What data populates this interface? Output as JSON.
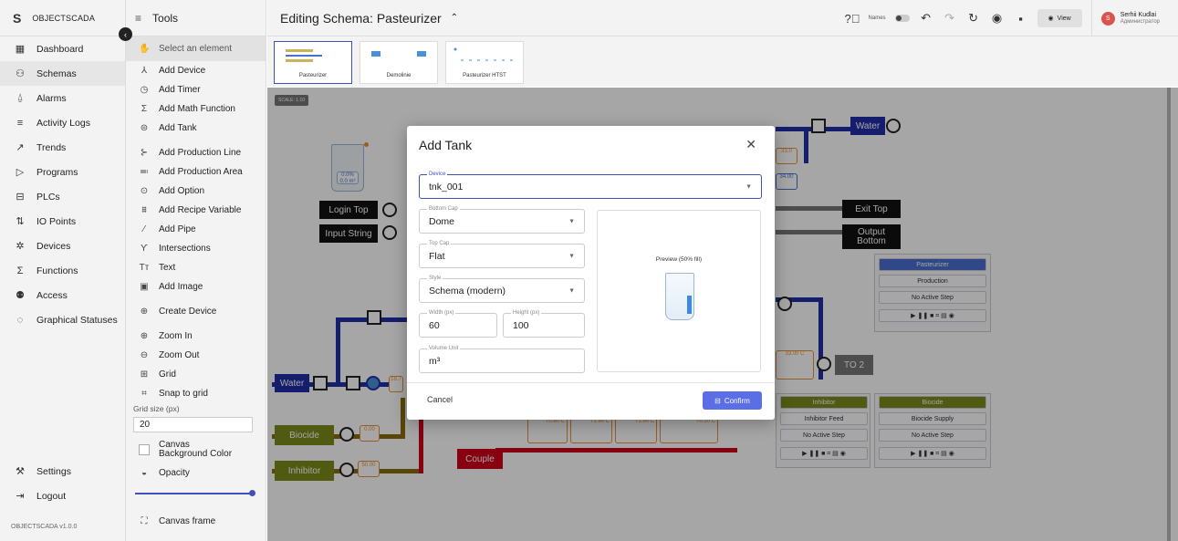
{
  "app": {
    "logo": "S",
    "name": "OBJECTSCADA",
    "version": "OBJECTSCADA v1.0.0"
  },
  "nav": {
    "items": [
      {
        "label": "Dashboard",
        "icon": "dashboard-icon",
        "glyph": "▦"
      },
      {
        "label": "Schemas",
        "icon": "schemas-icon",
        "glyph": "⚇",
        "active": true
      },
      {
        "label": "Alarms",
        "icon": "bell-icon",
        "glyph": "⍙"
      },
      {
        "label": "Activity Logs",
        "icon": "list-icon",
        "glyph": "≡"
      },
      {
        "label": "Trends",
        "icon": "trend-icon",
        "glyph": "↗"
      },
      {
        "label": "Programs",
        "icon": "play-icon",
        "glyph": "▷"
      },
      {
        "label": "PLCs",
        "icon": "plc-icon",
        "glyph": "⊟"
      },
      {
        "label": "IO Points",
        "icon": "io-icon",
        "glyph": "⇅"
      },
      {
        "label": "Devices",
        "icon": "gear-icon",
        "glyph": "✲"
      },
      {
        "label": "Functions",
        "icon": "sigma-icon",
        "glyph": "Σ"
      },
      {
        "label": "Access",
        "icon": "users-icon",
        "glyph": "⚉"
      },
      {
        "label": "Graphical Statuses",
        "icon": "status-icon",
        "glyph": "◌"
      }
    ],
    "settings": "Settings",
    "logout": "Logout"
  },
  "tools": {
    "title": "Tools",
    "select": "Select an element",
    "items": [
      {
        "label": "Add Device",
        "icon": "device-icon",
        "glyph": "⅄"
      },
      {
        "label": "Add Timer",
        "icon": "timer-icon",
        "glyph": "◷"
      },
      {
        "label": "Add Math Function",
        "icon": "sigma-icon",
        "glyph": "Σ"
      },
      {
        "label": "Add Tank",
        "icon": "tank-icon",
        "glyph": "⊜"
      },
      {
        "label": "Add Production Line",
        "icon": "production-line-icon",
        "glyph": "⊱"
      },
      {
        "label": "Add Production Area",
        "icon": "production-area-icon",
        "glyph": "≕"
      },
      {
        "label": "Add Option",
        "icon": "option-icon",
        "glyph": "⊙"
      },
      {
        "label": "Add Recipe Variable",
        "icon": "recipe-icon",
        "glyph": "⩩"
      },
      {
        "label": "Add Pipe",
        "icon": "pipe-icon",
        "glyph": "⁄"
      },
      {
        "label": "Intersections",
        "icon": "intersection-icon",
        "glyph": "Ƴ"
      },
      {
        "label": "Text",
        "icon": "text-icon",
        "glyph": "Tт"
      },
      {
        "label": "Add Image",
        "icon": "image-icon",
        "glyph": "▣"
      },
      {
        "label": "Create Device",
        "icon": "plus-circle-icon",
        "glyph": "⊕"
      },
      {
        "label": "Zoom In",
        "icon": "zoom-in-icon",
        "glyph": "⊕"
      },
      {
        "label": "Zoom Out",
        "icon": "zoom-out-icon",
        "glyph": "⊖"
      },
      {
        "label": "Grid",
        "icon": "grid-icon",
        "glyph": "⊞"
      },
      {
        "label": "Snap to grid",
        "icon": "snap-icon",
        "glyph": "⌗"
      }
    ],
    "grid_size_label": "Grid size (px)",
    "grid_size": "20",
    "canvas_bg": "Canvas Background Color",
    "opacity": "Opacity",
    "canvas_frame": "Canvas frame"
  },
  "header": {
    "title": "Editing Schema: Pasteurizer",
    "names": "Names",
    "view": "View",
    "user_name": "Serhii Kudlai",
    "user_role": "Администратор",
    "avatar": "S"
  },
  "schema_tabs": [
    "Pasteurizer",
    "Demolinie",
    "Pasteurizer HTST"
  ],
  "canvas": {
    "scale": "SCALE: 1.10",
    "tank_value": "0.0%\n0.0 m³",
    "login_top": "Login Top",
    "input_string": "Input String",
    "water_left": "Water",
    "biocide": "Biocide",
    "inhibitor": "Inhibitor",
    "couple": "Couple",
    "water_right": "Water",
    "exit_top": "Exit Top",
    "output_bottom": "Output Bottom",
    "to2": "TO 2",
    "val_biocide": "0.00",
    "val_inhibitor": "50.00",
    "val_33": "33.0",
    "val_34": "34.00",
    "val_18": "18.7",
    "val_33b": "33.00 C",
    "temps": [
      "70.80 C",
      "71.90 C",
      "71.90 C",
      "70.20 C"
    ],
    "panel_pasteurizer": [
      "Pasteurizer",
      "Production",
      "No Active Step"
    ],
    "panel_inhibitor": [
      "Inhibitor",
      "Inhibitor Feed",
      "No Active Step"
    ],
    "panel_biocide": [
      "Biocide",
      "Biocide Supply",
      "No Active Step"
    ]
  },
  "modal": {
    "title": "Add Tank",
    "device": {
      "label": "Device",
      "value": "tnk_001"
    },
    "bottom_cap": {
      "label": "Bottom Cap",
      "value": "Dome"
    },
    "top_cap": {
      "label": "Top Cap",
      "value": "Flat"
    },
    "style": {
      "label": "Style",
      "value": "Schema (modern)"
    },
    "width": {
      "label": "Width (px)",
      "value": "60"
    },
    "height": {
      "label": "Height (px)",
      "value": "100"
    },
    "volume_unit": {
      "label": "Volume Unit",
      "value": "m³"
    },
    "preview": "Preview (50% fill)",
    "preview_fill": 0.5,
    "cancel": "Cancel",
    "confirm": "Confirm"
  },
  "colors": {
    "accent": "#3f51b5",
    "pipe_blue": "#1f2fa8",
    "pipe_red": "#d0021b",
    "olive": "#7b8a1a",
    "orange": "#e69138"
  }
}
